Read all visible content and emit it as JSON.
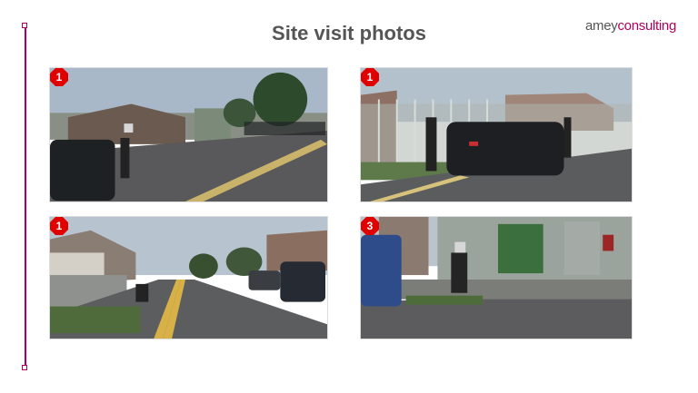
{
  "slide": {
    "title": "Site visit photos",
    "logo": {
      "part1": "amey",
      "part2": "consulting"
    },
    "accent_color": "#b0005f",
    "photos": [
      {
        "badge": "1",
        "scene": "road with pedestrians near bus shelter"
      },
      {
        "badge": "1",
        "scene": "dark car beside school gates"
      },
      {
        "badge": "1",
        "scene": "residential street with parked cars"
      },
      {
        "badge": "3",
        "scene": "pedestrian walking past green doors"
      }
    ]
  }
}
